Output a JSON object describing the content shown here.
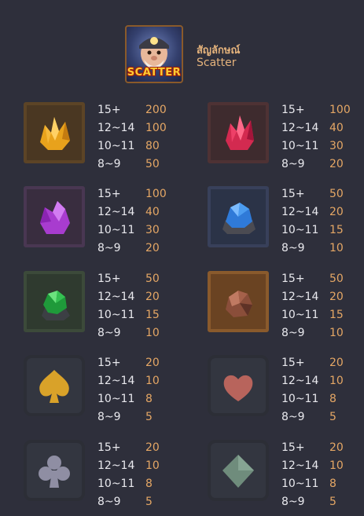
{
  "scatter": {
    "title": "สัญลักษณ์",
    "subtitle": "Scatter",
    "logo_text": "SCATTER"
  },
  "colors": {
    "background": "#2e2f3b",
    "count_text": "#e9e9ee",
    "payout_text": "#e5a765",
    "title_text": "#e5b37c"
  },
  "symbols": [
    {
      "icon": "yellow-crystal-icon",
      "pays": [
        {
          "count": "15+",
          "value": "200"
        },
        {
          "count": "12~14",
          "value": "100"
        },
        {
          "count": "10~11",
          "value": "80"
        },
        {
          "count": "8~9",
          "value": "50"
        }
      ]
    },
    {
      "icon": "red-crystal-icon",
      "pays": [
        {
          "count": "15+",
          "value": "100"
        },
        {
          "count": "12~14",
          "value": "40"
        },
        {
          "count": "10~11",
          "value": "30"
        },
        {
          "count": "8~9",
          "value": "20"
        }
      ]
    },
    {
      "icon": "purple-crystal-icon",
      "pays": [
        {
          "count": "15+",
          "value": "100"
        },
        {
          "count": "12~14",
          "value": "40"
        },
        {
          "count": "10~11",
          "value": "30"
        },
        {
          "count": "8~9",
          "value": "20"
        }
      ]
    },
    {
      "icon": "blue-crystal-icon",
      "pays": [
        {
          "count": "15+",
          "value": "50"
        },
        {
          "count": "12~14",
          "value": "20"
        },
        {
          "count": "10~11",
          "value": "15"
        },
        {
          "count": "8~9",
          "value": "10"
        }
      ]
    },
    {
      "icon": "green-gem-icon",
      "pays": [
        {
          "count": "15+",
          "value": "50"
        },
        {
          "count": "12~14",
          "value": "20"
        },
        {
          "count": "10~11",
          "value": "15"
        },
        {
          "count": "8~9",
          "value": "10"
        }
      ]
    },
    {
      "icon": "copper-ore-icon",
      "pays": [
        {
          "count": "15+",
          "value": "50"
        },
        {
          "count": "12~14",
          "value": "20"
        },
        {
          "count": "10~11",
          "value": "15"
        },
        {
          "count": "8~9",
          "value": "10"
        }
      ]
    },
    {
      "icon": "spade-icon",
      "pays": [
        {
          "count": "15+",
          "value": "20"
        },
        {
          "count": "12~14",
          "value": "10"
        },
        {
          "count": "10~11",
          "value": "8"
        },
        {
          "count": "8~9",
          "value": "5"
        }
      ]
    },
    {
      "icon": "heart-icon",
      "pays": [
        {
          "count": "15+",
          "value": "20"
        },
        {
          "count": "12~14",
          "value": "10"
        },
        {
          "count": "10~11",
          "value": "8"
        },
        {
          "count": "8~9",
          "value": "5"
        }
      ]
    },
    {
      "icon": "club-icon",
      "pays": [
        {
          "count": "15+",
          "value": "20"
        },
        {
          "count": "12~14",
          "value": "10"
        },
        {
          "count": "10~11",
          "value": "8"
        },
        {
          "count": "8~9",
          "value": "5"
        }
      ]
    },
    {
      "icon": "diamond-icon",
      "pays": [
        {
          "count": "15+",
          "value": "20"
        },
        {
          "count": "12~14",
          "value": "10"
        },
        {
          "count": "10~11",
          "value": "8"
        },
        {
          "count": "8~9",
          "value": "5"
        }
      ]
    }
  ]
}
